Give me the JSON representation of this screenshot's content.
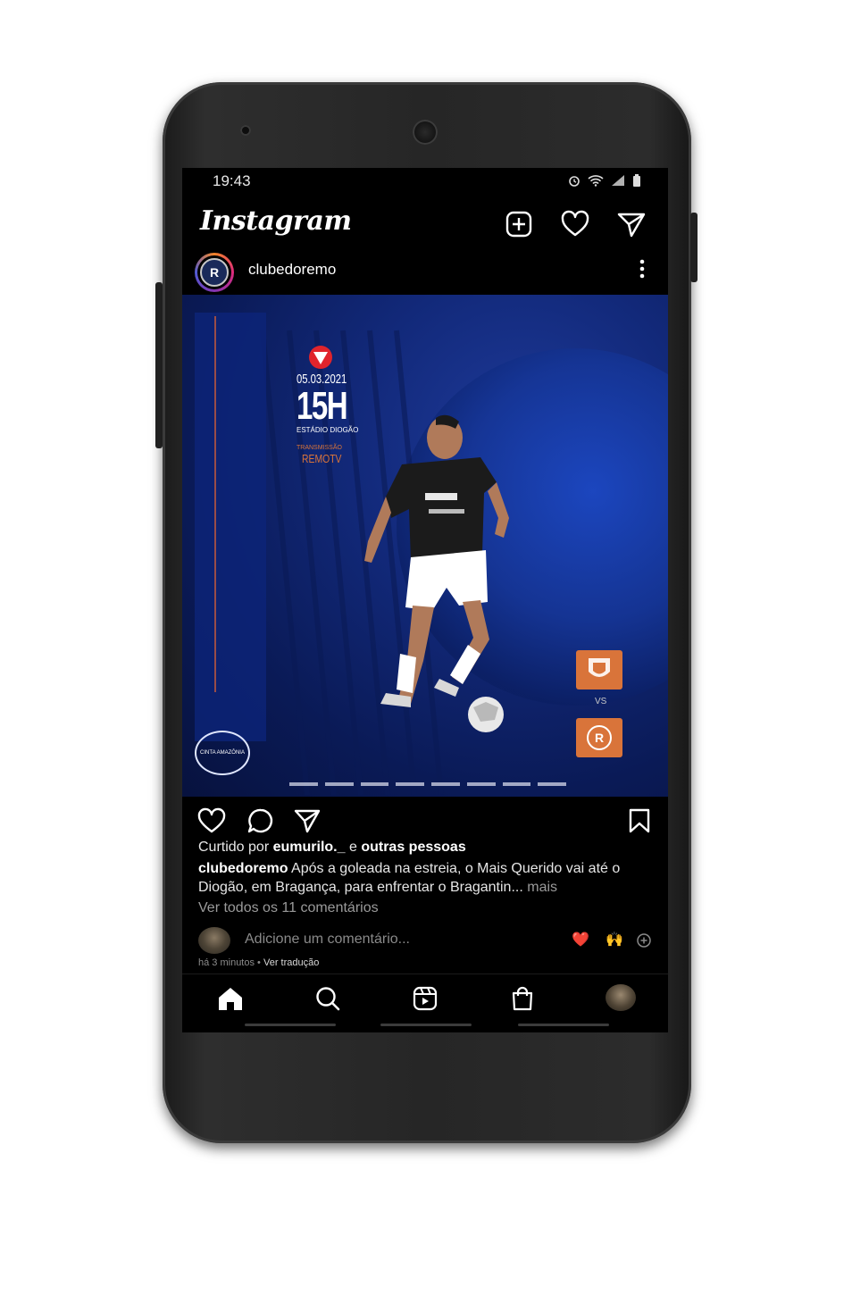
{
  "status_bar": {
    "time": "19:43",
    "icons": [
      "alarm-icon",
      "wifi-icon",
      "signal-icon",
      "battery-icon"
    ]
  },
  "header": {
    "app_name": "Instagram",
    "actions": [
      "new-post-icon",
      "heart-icon",
      "direct-message-icon"
    ]
  },
  "post": {
    "username": "clubedoremo",
    "image": {
      "date": "05.03.2021",
      "time": "15H",
      "venue": "ESTÁDIO DIOGÃO",
      "broadcast_label": "TRANSMISSÃO",
      "broadcast_channel": "REMOTV",
      "vs": "VS",
      "badge_text": "CINTA AMAZÔNIA"
    },
    "liked_by_prefix": "Curtido por",
    "liked_by_user": "eumurilo._",
    "liked_by_suffix": "e",
    "liked_by_others": "outras pessoas",
    "caption_user": "clubedoremo",
    "caption_text": "Após a goleada na estreia, o Mais Querido vai até o Diogão, em Bragança, para enfrentar o Bragantin...",
    "caption_more": "mais",
    "view_comments": "Ver todos os 11 comentários",
    "comment_placeholder": "Adicione um comentário...",
    "quick_emojis": [
      "❤️",
      "🙌"
    ],
    "time_ago": "há 3 minutos",
    "separator": "•",
    "see_translation": "Ver tradução"
  },
  "colors": {
    "background": "#000000",
    "post_blue": "#12297a",
    "accent_red": "#e0242c",
    "crest_orange": "#d9743a"
  },
  "bottom_nav": [
    "home-icon",
    "search-icon",
    "reels-icon",
    "shop-icon",
    "profile-avatar"
  ]
}
